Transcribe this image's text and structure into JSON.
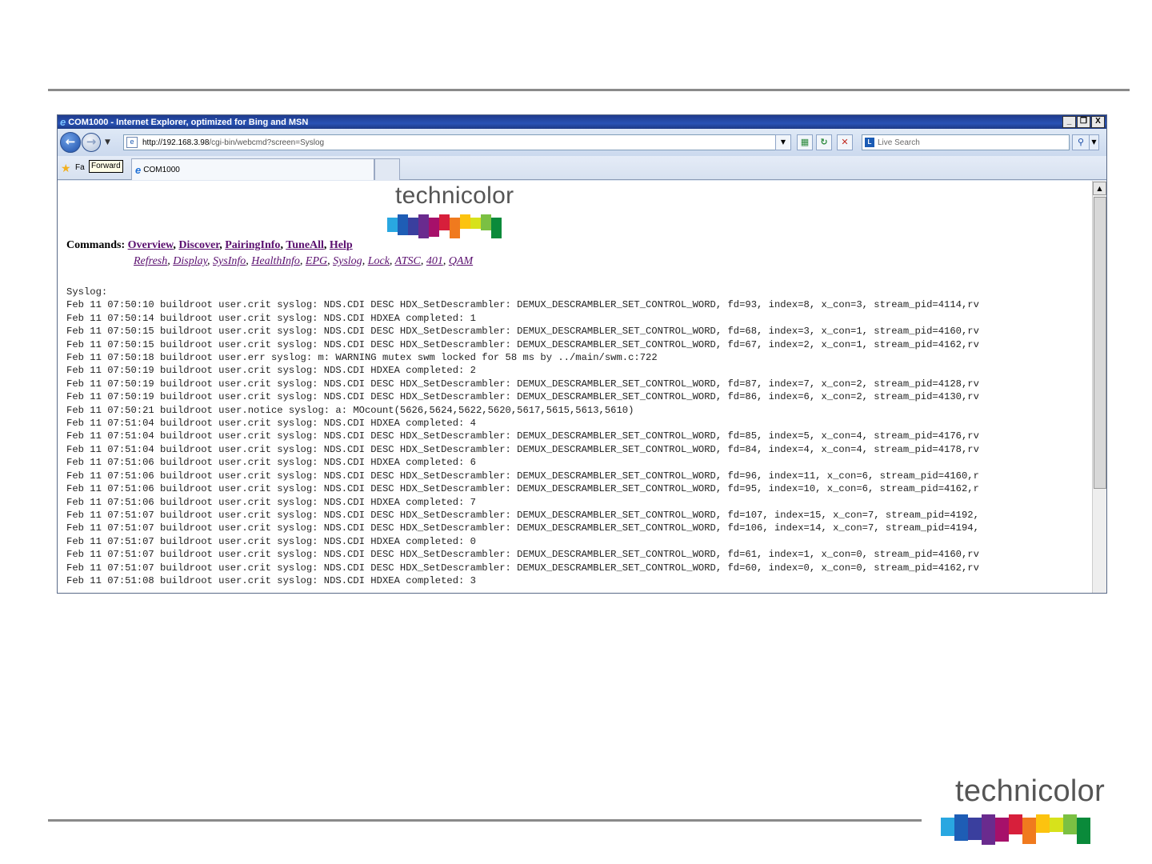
{
  "window": {
    "title": "COM1000 - Internet Explorer, optimized for Bing and MSN",
    "controls": [
      "_",
      "❐",
      "X"
    ]
  },
  "address_bar": {
    "url_host": "http://192.168.3.98",
    "url_path": "/cgi-bin/webcmd?screen=Syslog",
    "search_placeholder": "Live Search"
  },
  "favorites_bar": {
    "label": "Fa",
    "tooltip": "Forward",
    "tab_title": "COM1000"
  },
  "page": {
    "logo_text": "technicolor",
    "commands_label": "Commands:",
    "primary_commands": [
      "Overview",
      "Discover",
      "PairingInfo",
      "TuneAll",
      "Help"
    ],
    "secondary_commands": [
      "Refresh",
      "Display",
      "SysInfo",
      "HealthInfo",
      "EPG",
      "Syslog",
      "Lock",
      "ATSC",
      "401",
      "QAM"
    ],
    "syslog_header": "Syslog:",
    "syslog_lines": [
      "Feb 11 07:50:10 buildroot user.crit syslog: NDS.CDI DESC HDX_SetDescrambler: DEMUX_DESCRAMBLER_SET_CONTROL_WORD, fd=93, index=8, x_con=3, stream_pid=4114,rv",
      "Feb 11 07:50:14 buildroot user.crit syslog: NDS.CDI HDXEA completed: 1",
      "Feb 11 07:50:15 buildroot user.crit syslog: NDS.CDI DESC HDX_SetDescrambler: DEMUX_DESCRAMBLER_SET_CONTROL_WORD, fd=68, index=3, x_con=1, stream_pid=4160,rv",
      "Feb 11 07:50:15 buildroot user.crit syslog: NDS.CDI DESC HDX_SetDescrambler: DEMUX_DESCRAMBLER_SET_CONTROL_WORD, fd=67, index=2, x_con=1, stream_pid=4162,rv",
      "Feb 11 07:50:18 buildroot user.err syslog: m: WARNING mutex swm locked for 58 ms by ../main/swm.c:722",
      "Feb 11 07:50:19 buildroot user.crit syslog: NDS.CDI HDXEA completed: 2",
      "Feb 11 07:50:19 buildroot user.crit syslog: NDS.CDI DESC HDX_SetDescrambler: DEMUX_DESCRAMBLER_SET_CONTROL_WORD, fd=87, index=7, x_con=2, stream_pid=4128,rv",
      "Feb 11 07:50:19 buildroot user.crit syslog: NDS.CDI DESC HDX_SetDescrambler: DEMUX_DESCRAMBLER_SET_CONTROL_WORD, fd=86, index=6, x_con=2, stream_pid=4130,rv",
      "Feb 11 07:50:21 buildroot user.notice syslog: a: MOcount(5626,5624,5622,5620,5617,5615,5613,5610)",
      "Feb 11 07:51:04 buildroot user.crit syslog: NDS.CDI HDXEA completed: 4",
      "Feb 11 07:51:04 buildroot user.crit syslog: NDS.CDI DESC HDX_SetDescrambler: DEMUX_DESCRAMBLER_SET_CONTROL_WORD, fd=85, index=5, x_con=4, stream_pid=4176,rv",
      "Feb 11 07:51:04 buildroot user.crit syslog: NDS.CDI DESC HDX_SetDescrambler: DEMUX_DESCRAMBLER_SET_CONTROL_WORD, fd=84, index=4, x_con=4, stream_pid=4178,rv",
      "Feb 11 07:51:06 buildroot user.crit syslog: NDS.CDI HDXEA completed: 6",
      "Feb 11 07:51:06 buildroot user.crit syslog: NDS.CDI DESC HDX_SetDescrambler: DEMUX_DESCRAMBLER_SET_CONTROL_WORD, fd=96, index=11, x_con=6, stream_pid=4160,r",
      "Feb 11 07:51:06 buildroot user.crit syslog: NDS.CDI DESC HDX_SetDescrambler: DEMUX_DESCRAMBLER_SET_CONTROL_WORD, fd=95, index=10, x_con=6, stream_pid=4162,r",
      "Feb 11 07:51:06 buildroot user.crit syslog: NDS.CDI HDXEA completed: 7",
      "Feb 11 07:51:07 buildroot user.crit syslog: NDS.CDI DESC HDX_SetDescrambler: DEMUX_DESCRAMBLER_SET_CONTROL_WORD, fd=107, index=15, x_con=7, stream_pid=4192,",
      "Feb 11 07:51:07 buildroot user.crit syslog: NDS.CDI DESC HDX_SetDescrambler: DEMUX_DESCRAMBLER_SET_CONTROL_WORD, fd=106, index=14, x_con=7, stream_pid=4194,",
      "Feb 11 07:51:07 buildroot user.crit syslog: NDS.CDI HDXEA completed: 0",
      "Feb 11 07:51:07 buildroot user.crit syslog: NDS.CDI DESC HDX_SetDescrambler: DEMUX_DESCRAMBLER_SET_CONTROL_WORD, fd=61, index=1, x_con=0, stream_pid=4160,rv",
      "Feb 11 07:51:07 buildroot user.crit syslog: NDS.CDI DESC HDX_SetDescrambler: DEMUX_DESCRAMBLER_SET_CONTROL_WORD, fd=60, index=0, x_con=0, stream_pid=4162,rv",
      "Feb 11 07:51:08 buildroot user.crit syslog: NDS.CDI HDXEA completed: 3"
    ]
  },
  "slide": {
    "logo_text": "technicolor"
  },
  "colors": {
    "link": "#5a0f6f",
    "titlebar": "#2852b5",
    "brand_bars": [
      "#29a7e1",
      "#1e5db5",
      "#3a3f9e",
      "#6a2b8e",
      "#a6106a",
      "#d71f3b",
      "#f07a1e",
      "#fcc30f",
      "#d7e21b",
      "#7bc043",
      "#0a8a3a"
    ]
  }
}
